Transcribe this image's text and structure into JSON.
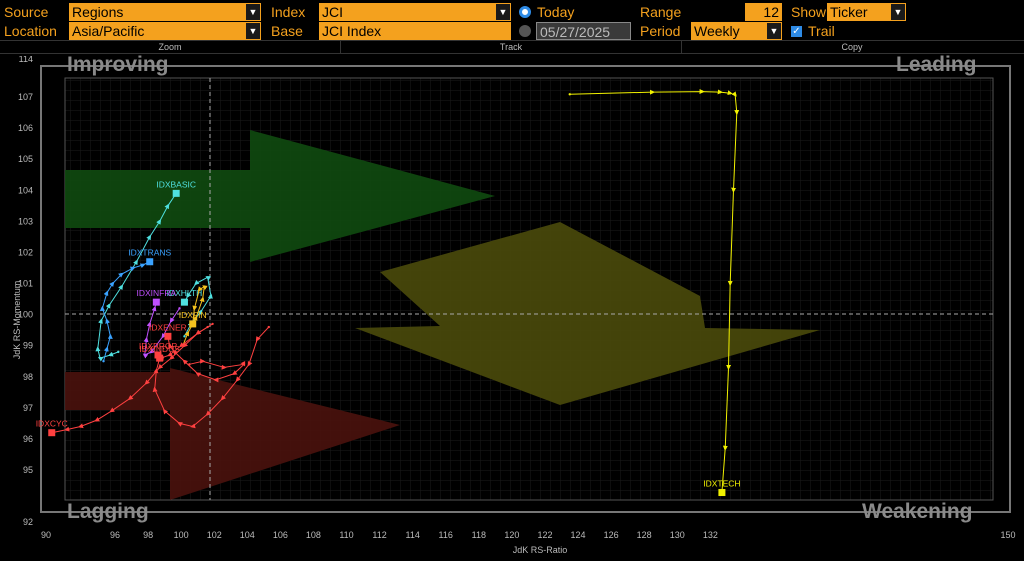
{
  "controls": {
    "source_label": "Source",
    "source_value": "Regions",
    "location_label": "Location",
    "location_value": "Asia/Pacific",
    "index_label": "Index",
    "index_value": "JCI",
    "base_label": "Base",
    "base_value": "JCI Index",
    "today_label": "Today",
    "date_value": "05/27/2025",
    "range_label": "Range",
    "range_value": "12",
    "period_label": "Period",
    "period_value": "Weekly",
    "show_label": "Show",
    "show_value": "Ticker",
    "trail_label": "Trail",
    "dropdown_glyph": "▼",
    "check_glyph": "✓"
  },
  "toolbar": {
    "zoom": "Zoom",
    "track": "Track",
    "copy": "Copy"
  },
  "quadrants": {
    "improving": "Improving",
    "leading": "Leading",
    "lagging": "Lagging",
    "weakening": "Weakening"
  },
  "colors": {
    "accent": "#f4a11e",
    "selected": "#2e8be6"
  },
  "chart_data": {
    "type": "scatter",
    "xlabel": "JdK RS-Ratio",
    "ylabel": "JdK RS-Momentum",
    "xlim": [
      90,
      150
    ],
    "ylim": [
      92,
      114
    ],
    "x_ticks": [
      90,
      96,
      98,
      100,
      102,
      104,
      106,
      108,
      110,
      112,
      114,
      116,
      118,
      120,
      122,
      124,
      126,
      128,
      130,
      132,
      150
    ],
    "y_ticks": [
      92,
      95,
      96,
      97,
      98,
      99,
      100,
      101,
      102,
      103,
      104,
      105,
      106,
      107,
      114
    ],
    "center": [
      100,
      100
    ],
    "series": [
      {
        "name": "IDXTECH",
        "color": "#f2f200",
        "points": [
          [
            123.5,
            107.5
          ],
          [
            128.5,
            107.9
          ],
          [
            131.5,
            108.0
          ],
          [
            132.6,
            107.9
          ],
          [
            133.2,
            107.7
          ],
          [
            133.5,
            107.4
          ],
          [
            133.6,
            106.5
          ],
          [
            133.4,
            104.0
          ],
          [
            133.2,
            101.0
          ],
          [
            133.1,
            98.3
          ],
          [
            132.9,
            95.7
          ],
          [
            132.7,
            93.7
          ]
        ]
      },
      {
        "name": "IDXBASIC",
        "color": "#4fe0e0",
        "points": [
          [
            96.2,
            98.8
          ],
          [
            95.6,
            98.7
          ],
          [
            94.7,
            98.6
          ],
          [
            94.5,
            98.9
          ],
          [
            94.8,
            99.8
          ],
          [
            95.5,
            100.3
          ],
          [
            96.4,
            100.9
          ],
          [
            97.3,
            101.7
          ],
          [
            98.1,
            102.5
          ],
          [
            98.7,
            103.0
          ],
          [
            99.2,
            103.5
          ],
          [
            99.7,
            103.9
          ]
        ]
      },
      {
        "name": "IDXTRANS",
        "color": "#3aa2ff",
        "points": [
          [
            95.0,
            98.5
          ],
          [
            95.3,
            98.9
          ],
          [
            95.6,
            99.3
          ],
          [
            95.3,
            99.8
          ],
          [
            94.9,
            100.2
          ],
          [
            95.3,
            100.7
          ],
          [
            95.8,
            101.0
          ],
          [
            96.4,
            101.3
          ],
          [
            97.1,
            101.5
          ],
          [
            97.7,
            101.6
          ],
          [
            98.1,
            101.7
          ]
        ]
      },
      {
        "name": "IDXHLTH",
        "color": "#4fe0e0",
        "points": [
          [
            100.2,
            99.3
          ],
          [
            100.6,
            99.7
          ],
          [
            101.2,
            100.1
          ],
          [
            101.8,
            100.6
          ],
          [
            101.6,
            101.2
          ],
          [
            100.9,
            101.0
          ],
          [
            100.4,
            100.6
          ],
          [
            100.2,
            100.4
          ]
        ]
      },
      {
        "name": "IDXINFRA",
        "color": "#c050ff",
        "points": [
          [
            99.9,
            100.2
          ],
          [
            99.4,
            99.8
          ],
          [
            98.9,
            99.3
          ],
          [
            98.2,
            98.8
          ],
          [
            97.8,
            98.7
          ],
          [
            97.9,
            99.2
          ],
          [
            98.1,
            99.7
          ],
          [
            98.4,
            100.2
          ],
          [
            98.5,
            100.4
          ]
        ]
      },
      {
        "name": "IDXFIN",
        "color": "#f4c21e",
        "points": [
          [
            100.1,
            99.0
          ],
          [
            100.4,
            99.4
          ],
          [
            100.9,
            99.9
          ],
          [
            101.3,
            100.5
          ],
          [
            101.4,
            100.9
          ],
          [
            101.1,
            100.8
          ],
          [
            100.8,
            100.2
          ],
          [
            100.7,
            99.7
          ]
        ]
      },
      {
        "name": "IDXENER",
        "color": "#ff4040",
        "points": [
          [
            100.5,
            98.4
          ],
          [
            101.3,
            98.5
          ],
          [
            102.6,
            98.3
          ],
          [
            103.8,
            98.4
          ],
          [
            103.2,
            98.1
          ],
          [
            102.1,
            97.9
          ],
          [
            101.0,
            98.1
          ],
          [
            100.2,
            98.5
          ],
          [
            99.6,
            98.8
          ],
          [
            99.3,
            99.0
          ],
          [
            99.2,
            99.3
          ]
        ]
      },
      {
        "name": "IDXCYC",
        "color": "#ff4040",
        "points": [
          [
            101.6,
            99.6
          ],
          [
            101.0,
            99.4
          ],
          [
            100.2,
            99.0
          ],
          [
            99.4,
            98.6
          ],
          [
            98.7,
            98.3
          ],
          [
            97.9,
            97.8
          ],
          [
            96.9,
            97.3
          ],
          [
            95.7,
            96.9
          ],
          [
            94.4,
            96.6
          ],
          [
            93.0,
            96.4
          ],
          [
            91.8,
            96.3
          ],
          [
            90.5,
            96.2
          ]
        ]
      },
      {
        "name": "IDXINDUS",
        "color": "#ff4040",
        "points": [
          [
            105.3,
            99.6
          ],
          [
            104.6,
            99.2
          ],
          [
            104.1,
            98.4
          ],
          [
            103.4,
            97.9
          ],
          [
            102.5,
            97.3
          ],
          [
            101.6,
            96.8
          ],
          [
            100.7,
            96.4
          ],
          [
            99.9,
            96.5
          ],
          [
            99.0,
            96.9
          ],
          [
            98.4,
            97.6
          ],
          [
            98.5,
            98.2
          ],
          [
            98.7,
            98.6
          ]
        ]
      },
      {
        "name": "IDXPROP",
        "color": "#ff4040",
        "points": [
          [
            101.9,
            99.7
          ],
          [
            101.0,
            99.4
          ],
          [
            100.0,
            99.0
          ],
          [
            99.3,
            98.7
          ],
          [
            98.8,
            98.6
          ],
          [
            98.6,
            98.7
          ]
        ]
      }
    ]
  }
}
